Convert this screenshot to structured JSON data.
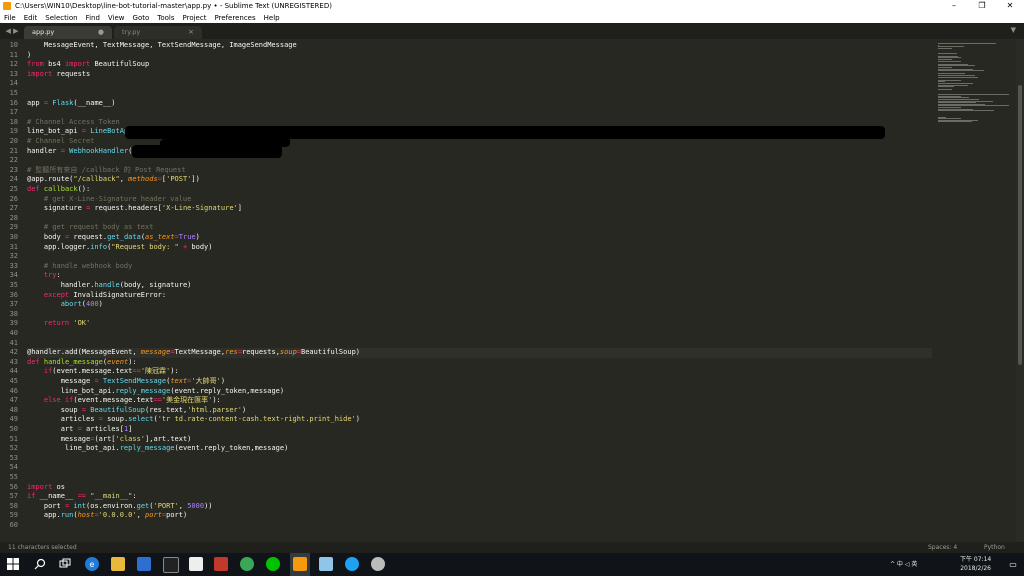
{
  "window": {
    "title": "C:\\Users\\WIN10\\Desktop\\line-bot-tutorial-master\\app.py • - Sublime Text (UNREGISTERED)",
    "controls": {
      "minimize": "–",
      "maximize": "❐",
      "close": "✕"
    }
  },
  "menu": [
    "File",
    "Edit",
    "Selection",
    "Find",
    "View",
    "Goto",
    "Tools",
    "Project",
    "Preferences",
    "Help"
  ],
  "tabs": [
    {
      "label": "app.py",
      "mark": "●",
      "active": true
    },
    {
      "label": "try.py",
      "mark": "×",
      "active": false
    }
  ],
  "tab_nav": "◀ ▶",
  "tab_dropdown": "▼",
  "code_lines": [
    {
      "n": "10",
      "tokens": [
        [
          "    MessageEvent, TextMessage, TextSendMessage, ImageSendMessage",
          "st"
        ]
      ]
    },
    {
      "n": "11",
      "tokens": [
        [
          ")",
          "st"
        ]
      ]
    },
    {
      "n": "12",
      "tokens": [
        [
          "from",
          "k"
        ],
        [
          " bs4 ",
          "st"
        ],
        [
          "import",
          "k"
        ],
        [
          " BeautifulSoup",
          "st"
        ]
      ]
    },
    {
      "n": "13",
      "tokens": [
        [
          "import",
          "k"
        ],
        [
          " requests",
          "st"
        ]
      ]
    },
    {
      "n": "14",
      "tokens": []
    },
    {
      "n": "15",
      "tokens": []
    },
    {
      "n": "16",
      "tokens": [
        [
          "app ",
          "st"
        ],
        [
          "=",
          "k"
        ],
        [
          " ",
          "st"
        ],
        [
          "Flask",
          "f"
        ],
        [
          "(__name__)",
          "st"
        ]
      ]
    },
    {
      "n": "17",
      "tokens": []
    },
    {
      "n": "18",
      "tokens": [
        [
          "# Channel Access Token",
          "c"
        ]
      ]
    },
    {
      "n": "19",
      "tokens": [
        [
          "line_bot_api ",
          "st"
        ],
        [
          "=",
          "k"
        ],
        [
          " ",
          "st"
        ],
        [
          "LineBotApi",
          "f"
        ],
        [
          "(",
          "st"
        ]
      ]
    },
    {
      "n": "20",
      "tokens": [
        [
          "# Channel Secret",
          "c"
        ]
      ]
    },
    {
      "n": "21",
      "tokens": [
        [
          "handler ",
          "st"
        ],
        [
          "=",
          "k"
        ],
        [
          " ",
          "st"
        ],
        [
          "WebhookHandler",
          "f"
        ],
        [
          "(",
          "st"
        ]
      ]
    },
    {
      "n": "22",
      "tokens": []
    },
    {
      "n": "23",
      "tokens": [
        [
          "# 監聽所有來自 /callback 的 Post Request",
          "c"
        ]
      ]
    },
    {
      "n": "24",
      "tokens": [
        [
          "@app.route(",
          "st"
        ],
        [
          "\"/callback\"",
          "s"
        ],
        [
          ", ",
          "st"
        ],
        [
          "methods",
          "p"
        ],
        [
          "=",
          "k"
        ],
        [
          "[",
          "st"
        ],
        [
          "'POST'",
          "s"
        ],
        [
          "])",
          "st"
        ]
      ]
    },
    {
      "n": "25",
      "tokens": [
        [
          "def",
          "k"
        ],
        [
          " ",
          "st"
        ],
        [
          "callback",
          "g"
        ],
        [
          "():",
          "st"
        ]
      ]
    },
    {
      "n": "26",
      "tokens": [
        [
          "    ",
          "st"
        ],
        [
          "# get X-Line-Signature header value",
          "c"
        ]
      ]
    },
    {
      "n": "27",
      "tokens": [
        [
          "    signature ",
          "st"
        ],
        [
          "=",
          "k"
        ],
        [
          " request.headers[",
          "st"
        ],
        [
          "'X-Line-Signature'",
          "s"
        ],
        [
          "]",
          "st"
        ]
      ]
    },
    {
      "n": "28",
      "tokens": []
    },
    {
      "n": "29",
      "tokens": [
        [
          "    ",
          "st"
        ],
        [
          "# get request body as text",
          "c"
        ]
      ]
    },
    {
      "n": "30",
      "tokens": [
        [
          "    body ",
          "st"
        ],
        [
          "=",
          "k"
        ],
        [
          " request.",
          "st"
        ],
        [
          "get_data",
          "f"
        ],
        [
          "(",
          "st"
        ],
        [
          "as_text",
          "p"
        ],
        [
          "=",
          "k"
        ],
        [
          "True",
          "n"
        ],
        [
          ")",
          "st"
        ]
      ]
    },
    {
      "n": "31",
      "tokens": [
        [
          "    app.logger.",
          "st"
        ],
        [
          "info",
          "f"
        ],
        [
          "(",
          "st"
        ],
        [
          "\"Request body: \"",
          "s"
        ],
        [
          " ",
          "st"
        ],
        [
          "+",
          "k"
        ],
        [
          " body)",
          "st"
        ]
      ]
    },
    {
      "n": "32",
      "tokens": []
    },
    {
      "n": "33",
      "tokens": [
        [
          "    ",
          "st"
        ],
        [
          "# handle webhook body",
          "c"
        ]
      ]
    },
    {
      "n": "34",
      "tokens": [
        [
          "    ",
          "st"
        ],
        [
          "try",
          "k"
        ],
        [
          ":",
          "st"
        ]
      ]
    },
    {
      "n": "35",
      "tokens": [
        [
          "        handler.",
          "st"
        ],
        [
          "handle",
          "f"
        ],
        [
          "(body, signature)",
          "st"
        ]
      ]
    },
    {
      "n": "36",
      "tokens": [
        [
          "    ",
          "st"
        ],
        [
          "except",
          "k"
        ],
        [
          " InvalidSignatureError:",
          "st"
        ]
      ]
    },
    {
      "n": "37",
      "tokens": [
        [
          "        ",
          "st"
        ],
        [
          "abort",
          "f"
        ],
        [
          "(",
          "st"
        ],
        [
          "400",
          "n"
        ],
        [
          ")",
          "st"
        ]
      ]
    },
    {
      "n": "38",
      "tokens": []
    },
    {
      "n": "39",
      "tokens": [
        [
          "    ",
          "st"
        ],
        [
          "return",
          "k"
        ],
        [
          " ",
          "st"
        ],
        [
          "'OK'",
          "s"
        ]
      ]
    },
    {
      "n": "40",
      "tokens": []
    },
    {
      "n": "41",
      "tokens": []
    },
    {
      "n": "42",
      "tokens": [
        [
          "@handler.add",
          "st"
        ],
        [
          "(MessageEvent, ",
          "st"
        ],
        [
          "message",
          "p"
        ],
        [
          "=",
          "k"
        ],
        [
          "TextMessage,",
          "st"
        ],
        [
          "res",
          "p"
        ],
        [
          "=",
          "k"
        ],
        [
          "requests,",
          "st"
        ],
        [
          "soup",
          "p"
        ],
        [
          "=",
          "k"
        ],
        [
          "BeautifulSoup)",
          "st"
        ]
      ]
    },
    {
      "n": "43",
      "tokens": [
        [
          "def",
          "k"
        ],
        [
          " ",
          "st"
        ],
        [
          "handle_message",
          "g"
        ],
        [
          "(",
          "st"
        ],
        [
          "event",
          "p"
        ],
        [
          "):",
          "st"
        ]
      ]
    },
    {
      "n": "44",
      "tokens": [
        [
          "    ",
          "st"
        ],
        [
          "if",
          "k"
        ],
        [
          "(event.message.text",
          "st"
        ],
        [
          "==",
          "k"
        ],
        [
          "'陳冠霖'",
          "s"
        ],
        [
          "):",
          "st"
        ]
      ]
    },
    {
      "n": "45",
      "tokens": [
        [
          "        message ",
          "st"
        ],
        [
          "=",
          "k"
        ],
        [
          " ",
          "st"
        ],
        [
          "TextSendMessage",
          "f"
        ],
        [
          "(",
          "st"
        ],
        [
          "text",
          "p"
        ],
        [
          "=",
          "k"
        ],
        [
          "'大帥哥'",
          "s"
        ],
        [
          ")",
          "st"
        ]
      ]
    },
    {
      "n": "46",
      "tokens": [
        [
          "        line_bot_api.",
          "st"
        ],
        [
          "reply_message",
          "f"
        ],
        [
          "(event.reply_token,message)",
          "st"
        ]
      ]
    },
    {
      "n": "47",
      "tokens": [
        [
          "    ",
          "st"
        ],
        [
          "else if",
          "k"
        ],
        [
          "(event.message.text",
          "st"
        ],
        [
          "==",
          "k"
        ],
        [
          "'美金現在匯率'",
          "s"
        ],
        [
          "):",
          "st"
        ]
      ]
    },
    {
      "n": "48",
      "tokens": [
        [
          "        soup ",
          "st"
        ],
        [
          "=",
          "k"
        ],
        [
          " ",
          "st"
        ],
        [
          "BeautifulSoup",
          "f"
        ],
        [
          "(res.text,",
          "st"
        ],
        [
          "'html.parser'",
          "s"
        ],
        [
          ")",
          "st"
        ]
      ]
    },
    {
      "n": "49",
      "tokens": [
        [
          "        articles ",
          "st"
        ],
        [
          "=",
          "k"
        ],
        [
          " soup.",
          "st"
        ],
        [
          "select",
          "f"
        ],
        [
          "(",
          "st"
        ],
        [
          "'tr td.rate-content-cash.text-right.print_hide'",
          "s"
        ],
        [
          ")",
          "st"
        ]
      ]
    },
    {
      "n": "50",
      "tokens": [
        [
          "        art ",
          "st"
        ],
        [
          "=",
          "k"
        ],
        [
          " articles[",
          "st"
        ],
        [
          "1",
          "n"
        ],
        [
          "]",
          "st"
        ]
      ]
    },
    {
      "n": "51",
      "tokens": [
        [
          "        message",
          "st"
        ],
        [
          "=",
          "k"
        ],
        [
          "(art[",
          "st"
        ],
        [
          "'class'",
          "s"
        ],
        [
          "],art.text)",
          "st"
        ]
      ]
    },
    {
      "n": "52",
      "tokens": [
        [
          "         line_bot_api.",
          "st"
        ],
        [
          "reply_message",
          "f"
        ],
        [
          "(event.reply_token,message)",
          "st"
        ]
      ]
    },
    {
      "n": "53",
      "tokens": []
    },
    {
      "n": "54",
      "tokens": []
    },
    {
      "n": "55",
      "tokens": []
    },
    {
      "n": "56",
      "tokens": [
        [
          "import",
          "k"
        ],
        [
          " os",
          "st"
        ]
      ]
    },
    {
      "n": "57",
      "tokens": [
        [
          "if",
          "k"
        ],
        [
          " __name__ ",
          "st"
        ],
        [
          "==",
          "k"
        ],
        [
          " ",
          "st"
        ],
        [
          "\"__main__\"",
          "s"
        ],
        [
          ":",
          "st"
        ]
      ]
    },
    {
      "n": "58",
      "tokens": [
        [
          "    port ",
          "st"
        ],
        [
          "=",
          "k"
        ],
        [
          " ",
          "st"
        ],
        [
          "int",
          "f"
        ],
        [
          "(os.environ.",
          "st"
        ],
        [
          "get",
          "f"
        ],
        [
          "(",
          "st"
        ],
        [
          "'PORT'",
          "s"
        ],
        [
          ", ",
          "st"
        ],
        [
          "5000",
          "n"
        ],
        [
          "))",
          "st"
        ]
      ]
    },
    {
      "n": "59",
      "tokens": [
        [
          "    app.",
          "st"
        ],
        [
          "run",
          "f"
        ],
        [
          "(",
          "st"
        ],
        [
          "host",
          "p"
        ],
        [
          "=",
          "k"
        ],
        [
          "'0.0.0.0'",
          "s"
        ],
        [
          ", ",
          "st"
        ],
        [
          "port",
          "p"
        ],
        [
          "=",
          "k"
        ],
        [
          "port)",
          "st"
        ]
      ]
    },
    {
      "n": "60",
      "tokens": []
    }
  ],
  "status": {
    "selection": "11 characters selected",
    "spaces": "Spaces: 4",
    "syntax": "Python"
  },
  "taskbar": {
    "clock_time": "下午 07:14",
    "clock_date": "2018/2/26",
    "tray_text": "^ 中 ◁ 英"
  },
  "colors": {
    "keyword": "#f92672",
    "string": "#e6db74",
    "function": "#66d9ef",
    "comment": "#75715e",
    "number": "#ae81ff",
    "param": "#fd971f",
    "definition": "#a6e22e",
    "background": "#272822"
  }
}
